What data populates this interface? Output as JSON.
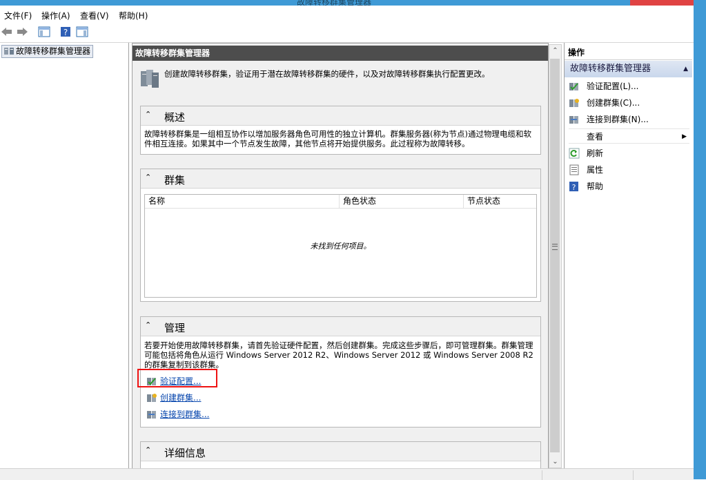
{
  "window": {
    "title": "故障转移群集管理器"
  },
  "menu": [
    "文件(F)",
    "操作(A)",
    "查看(V)",
    "帮助(H)"
  ],
  "toolbar": {
    "icons": [
      "back-icon",
      "forward-icon",
      "show-tree-icon",
      "help-icon",
      "show-action-pane-icon"
    ]
  },
  "tree": {
    "root_label": "故障转移群集管理器"
  },
  "center": {
    "header": "故障转移群集管理器",
    "intro": "创建故障转移群集，验证用于潜在故障转移群集的硬件，以及对故障转移群集执行配置更改。",
    "overview": {
      "title": "概述",
      "text": "故障转移群集是一组相互协作以增加服务器角色可用性的独立计算机。群集服务器(称为节点)通过物理电缆和软件相互连接。如果其中一个节点发生故障，其他节点将开始提供服务。此过程称为故障转移。"
    },
    "clusters": {
      "title": "群集",
      "columns": [
        "名称",
        "角色状态",
        "节点状态"
      ],
      "empty": "未找到任何项目。"
    },
    "manage": {
      "title": "管理",
      "text": "若要开始使用故障转移群集，请首先验证硬件配置，然后创建群集。完成这些步骤后，即可管理群集。群集管理可能包括将角色从运行 Windows Server 2012 R2、Windows Server 2012 或 Windows Server 2008 R2 的群集复制到该群集。",
      "links": [
        "验证配置...",
        "创建群集...",
        "连接到群集..."
      ]
    },
    "details": {
      "title": "详细信息"
    }
  },
  "actions": {
    "title": "操作",
    "group": "故障转移群集管理器",
    "items": [
      "验证配置(L)...",
      "创建群集(C)...",
      "连接到群集(N)...",
      "查看",
      "刷新",
      "属性",
      "帮助"
    ]
  },
  "colors": {
    "accent": "#3f9ad6",
    "header_dark": "#4d4d4d",
    "highlight": "#e11111",
    "link": "#0645ad"
  }
}
